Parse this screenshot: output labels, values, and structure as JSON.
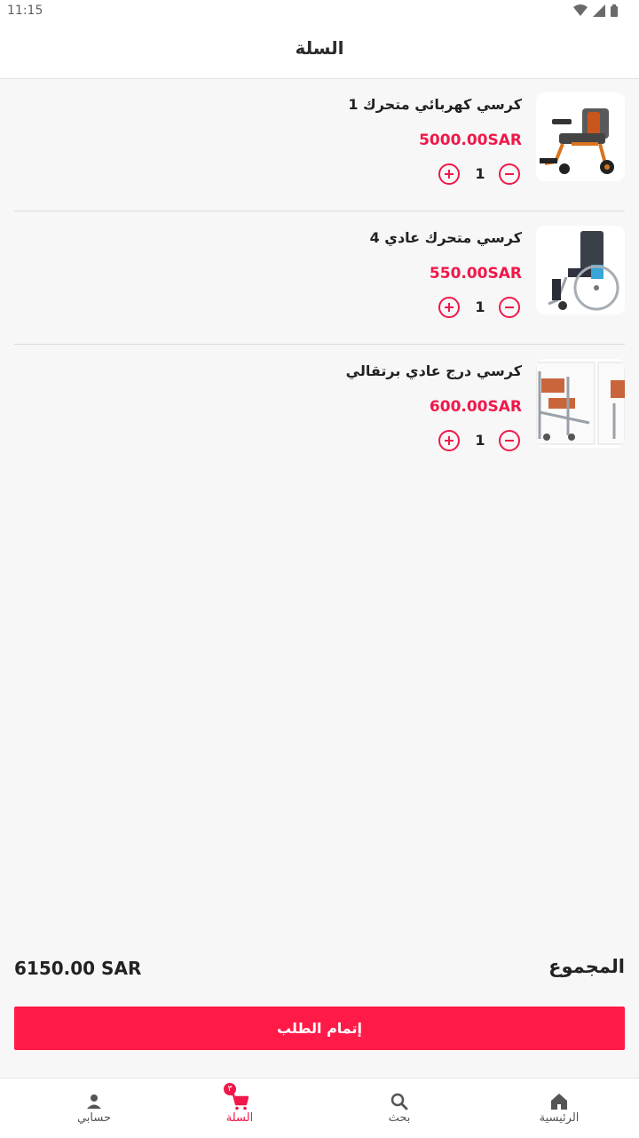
{
  "status_bar": {
    "time": "11:15"
  },
  "app_bar": {
    "title": "السلة"
  },
  "cart": {
    "items": [
      {
        "name": "كرسي كهربائي متحرك 1",
        "price": "5000.00SAR",
        "quantity": "1"
      },
      {
        "name": "كرسي متحرك عادي 4",
        "price": "550.00SAR",
        "quantity": "1"
      },
      {
        "name": "كرسي درج عادي برتقالي",
        "price": "600.00SAR",
        "quantity": "1"
      }
    ]
  },
  "summary": {
    "total_label": "المجموع",
    "total_amount": "6150.00 SAR"
  },
  "checkout": {
    "label": "إتمام الطلب"
  },
  "bottom_nav": {
    "items": [
      {
        "label": "الرئيسية",
        "icon": "home-icon"
      },
      {
        "label": "بحث",
        "icon": "search-icon"
      },
      {
        "label": "السلة",
        "icon": "cart-icon",
        "badge": "٣"
      },
      {
        "label": "حسابي",
        "icon": "person-icon"
      }
    ]
  },
  "colors": {
    "accent": "#f0184a",
    "button": "#ff1a47",
    "background": "#f7f7f7"
  }
}
